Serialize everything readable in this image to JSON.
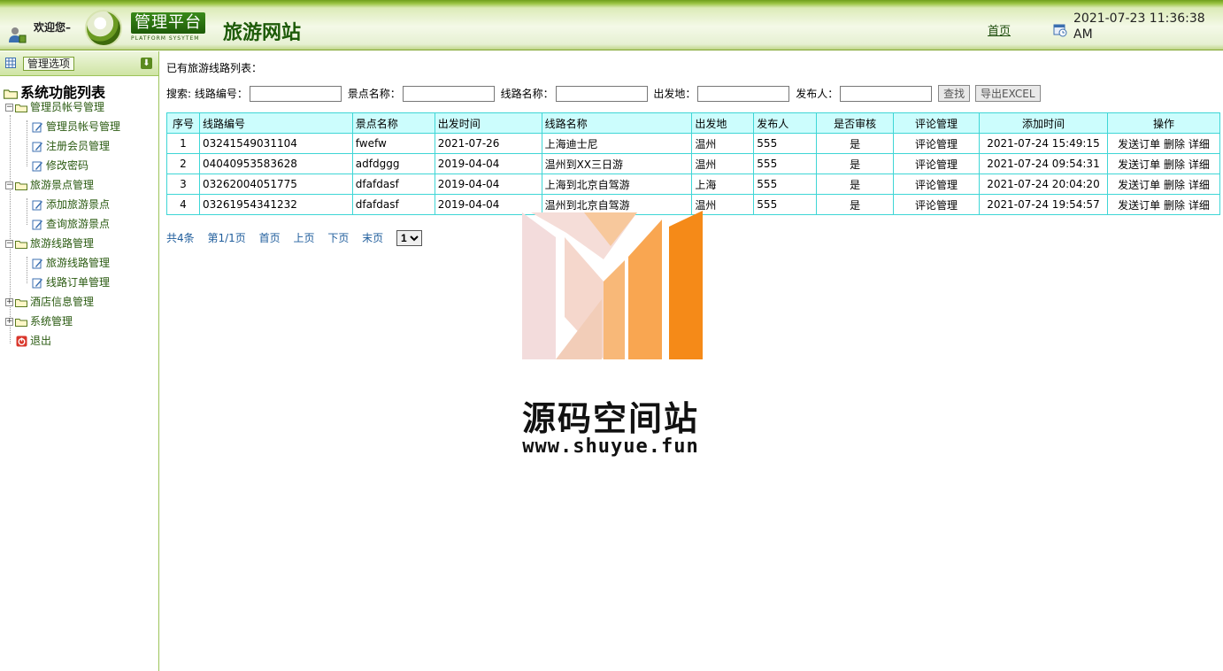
{
  "header": {
    "welcome": "欢迎您–",
    "badge_cn": "管理平台",
    "badge_en": "PLATFORM SYSYTEM",
    "site_title": "旅游网站",
    "home_link": "首页",
    "datetime": "2021-07-23 11:36:38 AM"
  },
  "sidebar": {
    "head_button": "管理选项",
    "root": "系统功能列表",
    "groups": [
      {
        "label": "管理员帐号管理",
        "children": [
          "管理员帐号管理",
          "注册会员管理",
          "修改密码"
        ]
      },
      {
        "label": "旅游景点管理",
        "children": [
          "添加旅游景点",
          "查询旅游景点"
        ]
      },
      {
        "label": "旅游线路管理",
        "children": [
          "旅游线路管理",
          "线路订单管理"
        ]
      },
      {
        "label": "酒店信息管理",
        "children": []
      },
      {
        "label": "系统管理",
        "children": []
      }
    ],
    "logout": "退出"
  },
  "main": {
    "list_title": "已有旅游线路列表：",
    "search": {
      "label": "搜索:",
      "f1": "线路编号：",
      "f2": "景点名称：",
      "f3": "线路名称：",
      "f4": "出发地：",
      "f5": "发布人：",
      "find_button": "查找",
      "export_button": "导出EXCEL"
    },
    "columns": [
      "序号",
      "线路编号",
      "景点名称",
      "出发时间",
      "线路名称",
      "出发地",
      "发布人",
      "是否审核",
      "评论管理",
      "添加时间",
      "操作"
    ],
    "rows": [
      {
        "no": "1",
        "code": "03241549031104",
        "spot": "fwefw",
        "depart_time": "2021-07-26",
        "route": "上海迪士尼",
        "from": "温州",
        "publisher": "555",
        "audited": "是",
        "comment": "评论管理",
        "added": "2021-07-24 15:49:15",
        "op1": "发送订单",
        "op2": "删除",
        "op3": "详细"
      },
      {
        "no": "2",
        "code": "04040953583628",
        "spot": "adfdggg",
        "depart_time": "2019-04-04",
        "route": "温州到XX三日游",
        "from": "温州",
        "publisher": "555",
        "audited": "是",
        "comment": "评论管理",
        "added": "2021-07-24 09:54:31",
        "op1": "发送订单",
        "op2": "删除",
        "op3": "详细"
      },
      {
        "no": "3",
        "code": "03262004051775",
        "spot": "dfafdasf",
        "depart_time": "2019-04-04",
        "route": "上海到北京自驾游",
        "from": "上海",
        "publisher": "555",
        "audited": "是",
        "comment": "评论管理",
        "added": "2021-07-24 20:04:20",
        "op1": "发送订单",
        "op2": "删除",
        "op3": "详细"
      },
      {
        "no": "4",
        "code": "03261954341232",
        "spot": "dfafdasf",
        "depart_time": "2019-04-04",
        "route": "温州到北京自驾游",
        "from": "温州",
        "publisher": "555",
        "audited": "是",
        "comment": "评论管理",
        "added": "2021-07-24 19:54:57",
        "op1": "发送订单",
        "op2": "删除",
        "op3": "详细"
      }
    ],
    "pager": {
      "total": "共4条",
      "page": "第1/1页",
      "first": "首页",
      "prev": "上页",
      "next": "下页",
      "last": "末页",
      "select_value": "1"
    }
  },
  "watermark": {
    "text": "源码空间站",
    "url": "www.shuyue.fun"
  },
  "colors": {
    "header_green": "#6f9e1c",
    "table_border": "#3fd6d6",
    "table_header_bg": "#ccfdfd",
    "link_blue": "#1f5d9c",
    "watermark_orange": "#f7941d"
  }
}
